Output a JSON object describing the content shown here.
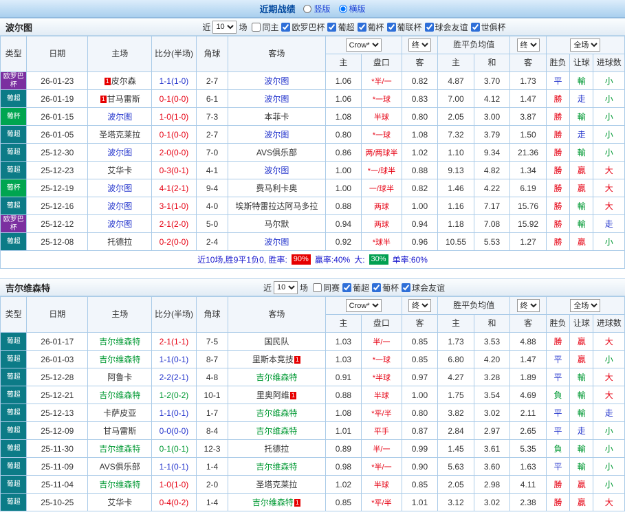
{
  "page": {
    "title": "近期战绩",
    "view_options": [
      {
        "label": "竖版",
        "selected": false
      },
      {
        "label": "横版",
        "selected": true
      }
    ]
  },
  "labels": {
    "near": "近",
    "games": "场",
    "red_badge": "1"
  },
  "columns": {
    "type": "类型",
    "date": "日期",
    "home": "主场",
    "score": "比分(半场)",
    "corner": "角球",
    "away": "客场",
    "odds_home": "主",
    "handicap": "盘口",
    "odds_away": "客",
    "avg_home": "主",
    "avg_draw": "和",
    "avg_away": "客",
    "wdl": "胜负",
    "handicap_result": "让球",
    "goals": "进球数",
    "book": "Crow*",
    "final": "终",
    "avg_title": "胜平负均值",
    "full": "全场"
  },
  "type_colors": {
    "europa": "#7b2fa0",
    "liga": "#0c7b87",
    "cup": "#00a550"
  },
  "score_colors": {
    "win": "#e60012",
    "draw": "#2233cc",
    "loss": "#009933"
  },
  "result_colors": {
    "勝": "#e60012",
    "贏": "#e60012",
    "大": "#e60012",
    "平": "#2233cc",
    "走": "#2233cc",
    "輸": "#009933",
    "負": "#009933",
    "小": "#009933"
  },
  "tables": [
    {
      "team": "波尔图",
      "count": "10",
      "focus_color": "#2233cc",
      "filters": [
        {
          "label": "同主",
          "checked": false
        },
        {
          "label": "欧罗巴杯",
          "checked": true
        },
        {
          "label": "葡超",
          "checked": true
        },
        {
          "label": "葡杯",
          "checked": true
        },
        {
          "label": "葡联杯",
          "checked": true
        },
        {
          "label": "球会友谊",
          "checked": true
        },
        {
          "label": "世俱杯",
          "checked": true
        }
      ],
      "rows": [
        {
          "type": "欧罗巴杯",
          "type_key": "europa",
          "date": "26-01-23",
          "home": "皮尔森",
          "home_focus": false,
          "home_badge": "before",
          "score": "1-1(1-0)",
          "score_key": "draw",
          "corner": "2-7",
          "away": "波尔图",
          "away_focus": true,
          "away_badge": null,
          "o1": "1.06",
          "hcap": "*半/一",
          "o2": "0.82",
          "a1": "4.87",
          "a2": "3.70",
          "a3": "1.73",
          "r1": "平",
          "r2": "輸",
          "r3": "小"
        },
        {
          "type": "葡超",
          "type_key": "liga",
          "date": "26-01-19",
          "home": "甘马雷斯",
          "home_focus": false,
          "home_badge": "before",
          "score": "0-1(0-0)",
          "score_key": "win",
          "corner": "6-1",
          "away": "波尔图",
          "away_focus": true,
          "away_badge": null,
          "o1": "1.06",
          "hcap": "*一球",
          "o2": "0.83",
          "a1": "7.00",
          "a2": "4.12",
          "a3": "1.47",
          "r1": "勝",
          "r2": "走",
          "r3": "小"
        },
        {
          "type": "葡杯",
          "type_key": "cup",
          "date": "26-01-15",
          "home": "波尔图",
          "home_focus": true,
          "home_badge": null,
          "score": "1-0(1-0)",
          "score_key": "win",
          "corner": "7-3",
          "away": "本菲卡",
          "away_focus": false,
          "away_badge": null,
          "o1": "1.08",
          "hcap": "半球",
          "o2": "0.80",
          "a1": "2.05",
          "a2": "3.00",
          "a3": "3.87",
          "r1": "勝",
          "r2": "輸",
          "r3": "小"
        },
        {
          "type": "葡超",
          "type_key": "liga",
          "date": "26-01-05",
          "home": "圣塔克莱拉",
          "home_focus": false,
          "home_badge": null,
          "score": "0-1(0-0)",
          "score_key": "win",
          "corner": "2-7",
          "away": "波尔图",
          "away_focus": true,
          "away_badge": null,
          "o1": "0.80",
          "hcap": "*一球",
          "o2": "1.08",
          "a1": "7.32",
          "a2": "3.79",
          "a3": "1.50",
          "r1": "勝",
          "r2": "走",
          "r3": "小"
        },
        {
          "type": "葡超",
          "type_key": "liga",
          "date": "25-12-30",
          "home": "波尔图",
          "home_focus": true,
          "home_badge": null,
          "score": "2-0(0-0)",
          "score_key": "win",
          "corner": "7-0",
          "away": "AVS俱乐部",
          "away_focus": false,
          "away_badge": null,
          "o1": "0.86",
          "hcap": "两/两球半",
          "o2": "1.02",
          "a1": "1.10",
          "a2": "9.34",
          "a3": "21.36",
          "r1": "勝",
          "r2": "輸",
          "r3": "小"
        },
        {
          "type": "葡超",
          "type_key": "liga",
          "date": "25-12-23",
          "home": "艾华卡",
          "home_focus": false,
          "home_badge": null,
          "score": "0-3(0-1)",
          "score_key": "win",
          "corner": "4-1",
          "away": "波尔图",
          "away_focus": true,
          "away_badge": null,
          "o1": "1.00",
          "hcap": "*一/球半",
          "o2": "0.88",
          "a1": "9.13",
          "a2": "4.82",
          "a3": "1.34",
          "r1": "勝",
          "r2": "贏",
          "r3": "大"
        },
        {
          "type": "葡杯",
          "type_key": "cup",
          "date": "25-12-19",
          "home": "波尔图",
          "home_focus": true,
          "home_badge": null,
          "score": "4-1(2-1)",
          "score_key": "win",
          "corner": "9-4",
          "away": "费马利卡奥",
          "away_focus": false,
          "away_badge": null,
          "o1": "1.00",
          "hcap": "一/球半",
          "o2": "0.82",
          "a1": "1.46",
          "a2": "4.22",
          "a3": "6.19",
          "r1": "勝",
          "r2": "贏",
          "r3": "大"
        },
        {
          "type": "葡超",
          "type_key": "liga",
          "date": "25-12-16",
          "home": "波尔图",
          "home_focus": true,
          "home_badge": null,
          "score": "3-1(1-0)",
          "score_key": "win",
          "corner": "4-0",
          "away": "埃斯特雷拉达阿马多拉",
          "away_focus": false,
          "away_badge": null,
          "o1": "0.88",
          "hcap": "两球",
          "o2": "1.00",
          "a1": "1.16",
          "a2": "7.17",
          "a3": "15.76",
          "r1": "勝",
          "r2": "輸",
          "r3": "大"
        },
        {
          "type": "欧罗巴杯",
          "type_key": "europa",
          "date": "25-12-12",
          "home": "波尔图",
          "home_focus": true,
          "home_badge": null,
          "score": "2-1(2-0)",
          "score_key": "win",
          "corner": "5-0",
          "away": "马尔默",
          "away_focus": false,
          "away_badge": null,
          "o1": "0.94",
          "hcap": "两球",
          "o2": "0.94",
          "a1": "1.18",
          "a2": "7.08",
          "a3": "15.92",
          "r1": "勝",
          "r2": "輸",
          "r3": "走"
        },
        {
          "type": "葡超",
          "type_key": "liga",
          "date": "25-12-08",
          "home": "托德拉",
          "home_focus": false,
          "home_badge": null,
          "score": "0-2(0-0)",
          "score_key": "win",
          "corner": "2-4",
          "away": "波尔图",
          "away_focus": true,
          "away_badge": null,
          "o1": "0.92",
          "hcap": "*球半",
          "o2": "0.96",
          "a1": "10.55",
          "a2": "5.53",
          "a3": "1.27",
          "r1": "勝",
          "r2": "贏",
          "r3": "小"
        }
      ],
      "summary": [
        {
          "t": "近10场,胜9平1负0, 胜率:"
        },
        {
          "b": "90%",
          "bg": "#e60000"
        },
        {
          "t": "贏率:40%"
        },
        {
          "t": "大:"
        },
        {
          "b": "30%",
          "bg": "#00a050"
        },
        {
          "t": "单率:60%"
        }
      ]
    },
    {
      "team": "吉尔维森特",
      "count": "10",
      "focus_color": "#009933",
      "filters": [
        {
          "label": "同赛",
          "checked": false
        },
        {
          "label": "葡超",
          "checked": true
        },
        {
          "label": "葡杯",
          "checked": true
        },
        {
          "label": "球会友谊",
          "checked": true
        }
      ],
      "rows": [
        {
          "type": "葡超",
          "type_key": "liga",
          "date": "26-01-17",
          "home": "吉尔维森特",
          "home_focus": true,
          "home_badge": null,
          "score": "2-1(1-1)",
          "score_key": "win",
          "corner": "7-5",
          "away": "国民队",
          "away_focus": false,
          "away_badge": null,
          "o1": "1.03",
          "hcap": "半/一",
          "o2": "0.85",
          "a1": "1.73",
          "a2": "3.53",
          "a3": "4.88",
          "r1": "勝",
          "r2": "贏",
          "r3": "大"
        },
        {
          "type": "葡超",
          "type_key": "liga",
          "date": "26-01-03",
          "home": "吉尔维森特",
          "home_focus": true,
          "home_badge": null,
          "score": "1-1(0-1)",
          "score_key": "draw",
          "corner": "8-7",
          "away": "里斯本竞技",
          "away_focus": false,
          "away_badge": "after",
          "o1": "1.03",
          "hcap": "*一球",
          "o2": "0.85",
          "a1": "6.80",
          "a2": "4.20",
          "a3": "1.47",
          "r1": "平",
          "r2": "贏",
          "r3": "小"
        },
        {
          "type": "葡超",
          "type_key": "liga",
          "date": "25-12-28",
          "home": "阿鲁卡",
          "home_focus": false,
          "home_badge": null,
          "score": "2-2(2-1)",
          "score_key": "draw",
          "corner": "4-8",
          "away": "吉尔维森特",
          "away_focus": true,
          "away_badge": null,
          "o1": "0.91",
          "hcap": "*半球",
          "o2": "0.97",
          "a1": "4.27",
          "a2": "3.28",
          "a3": "1.89",
          "r1": "平",
          "r2": "輸",
          "r3": "大"
        },
        {
          "type": "葡超",
          "type_key": "liga",
          "date": "25-12-21",
          "home": "吉尔维森特",
          "home_focus": true,
          "home_badge": null,
          "score": "1-2(0-2)",
          "score_key": "loss",
          "corner": "10-1",
          "away": "里奥阿维",
          "away_focus": false,
          "away_badge": "after",
          "o1": "0.88",
          "hcap": "半球",
          "o2": "1.00",
          "a1": "1.75",
          "a2": "3.54",
          "a3": "4.69",
          "r1": "負",
          "r2": "輸",
          "r3": "大"
        },
        {
          "type": "葡超",
          "type_key": "liga",
          "date": "25-12-13",
          "home": "卡萨皮亚",
          "home_focus": false,
          "home_badge": null,
          "score": "1-1(0-1)",
          "score_key": "draw",
          "corner": "1-7",
          "away": "吉尔维森特",
          "away_focus": true,
          "away_badge": null,
          "o1": "1.08",
          "hcap": "*平/半",
          "o2": "0.80",
          "a1": "3.82",
          "a2": "3.02",
          "a3": "2.11",
          "r1": "平",
          "r2": "輸",
          "r3": "走"
        },
        {
          "type": "葡超",
          "type_key": "liga",
          "date": "25-12-09",
          "home": "甘马雷斯",
          "home_focus": false,
          "home_badge": null,
          "score": "0-0(0-0)",
          "score_key": "draw",
          "corner": "8-4",
          "away": "吉尔维森特",
          "away_focus": true,
          "away_badge": null,
          "o1": "1.01",
          "hcap": "平手",
          "o2": "0.87",
          "a1": "2.84",
          "a2": "2.97",
          "a3": "2.65",
          "r1": "平",
          "r2": "走",
          "r3": "小"
        },
        {
          "type": "葡超",
          "type_key": "liga",
          "date": "25-11-30",
          "home": "吉尔维森特",
          "home_focus": true,
          "home_badge": null,
          "score": "0-1(0-1)",
          "score_key": "loss",
          "corner": "12-3",
          "away": "托德拉",
          "away_focus": false,
          "away_badge": null,
          "o1": "0.89",
          "hcap": "半/一",
          "o2": "0.99",
          "a1": "1.45",
          "a2": "3.61",
          "a3": "5.35",
          "r1": "負",
          "r2": "輸",
          "r3": "小"
        },
        {
          "type": "葡超",
          "type_key": "liga",
          "date": "25-11-09",
          "home": "AVS俱乐部",
          "home_focus": false,
          "home_badge": null,
          "score": "1-1(0-1)",
          "score_key": "draw",
          "corner": "1-4",
          "away": "吉尔维森特",
          "away_focus": true,
          "away_badge": null,
          "o1": "0.98",
          "hcap": "*半/一",
          "o2": "0.90",
          "a1": "5.63",
          "a2": "3.60",
          "a3": "1.63",
          "r1": "平",
          "r2": "輸",
          "r3": "小"
        },
        {
          "type": "葡超",
          "type_key": "liga",
          "date": "25-11-04",
          "home": "吉尔维森特",
          "home_focus": true,
          "home_badge": null,
          "score": "1-0(1-0)",
          "score_key": "win",
          "corner": "2-0",
          "away": "圣塔克莱拉",
          "away_focus": false,
          "away_badge": null,
          "o1": "1.02",
          "hcap": "半球",
          "o2": "0.85",
          "a1": "2.05",
          "a2": "2.98",
          "a3": "4.11",
          "r1": "勝",
          "r2": "贏",
          "r3": "小"
        },
        {
          "type": "葡超",
          "type_key": "liga",
          "date": "25-10-25",
          "home": "艾华卡",
          "home_focus": false,
          "home_badge": null,
          "score": "0-4(0-2)",
          "score_key": "win",
          "corner": "1-4",
          "away": "吉尔维森特",
          "away_focus": true,
          "away_badge": "after",
          "o1": "0.85",
          "hcap": "*平/半",
          "o2": "1.01",
          "a1": "3.12",
          "a2": "3.02",
          "a3": "2.38",
          "r1": "勝",
          "r2": "贏",
          "r3": "大"
        }
      ],
      "summary": null
    }
  ]
}
